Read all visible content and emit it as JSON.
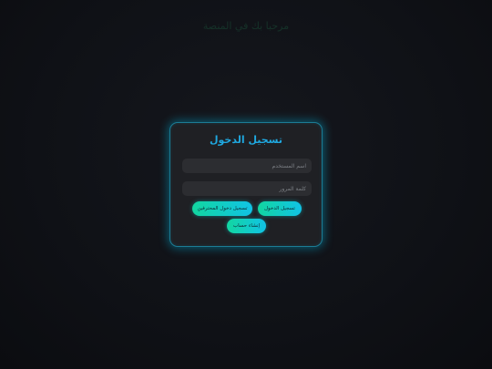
{
  "background": {
    "title": "مرحبا بك في المنصة"
  },
  "login_form": {
    "title": "تسجيل الدخول",
    "username": {
      "value": "",
      "placeholder": "اسم المستخدم"
    },
    "password": {
      "value": "",
      "placeholder": "كلمة المرور"
    },
    "buttons": {
      "login": "تسجيل الدخول",
      "pro_login": "تسجيل دخول المحترفين",
      "create_account": "إنشاء حساب"
    }
  },
  "colors": {
    "accent": "#1fa8e0",
    "button_gradient_start": "#12d6a0",
    "button_gradient_end": "#11c3e6",
    "card_background": "#1f2024",
    "page_background": "#0f1116"
  }
}
